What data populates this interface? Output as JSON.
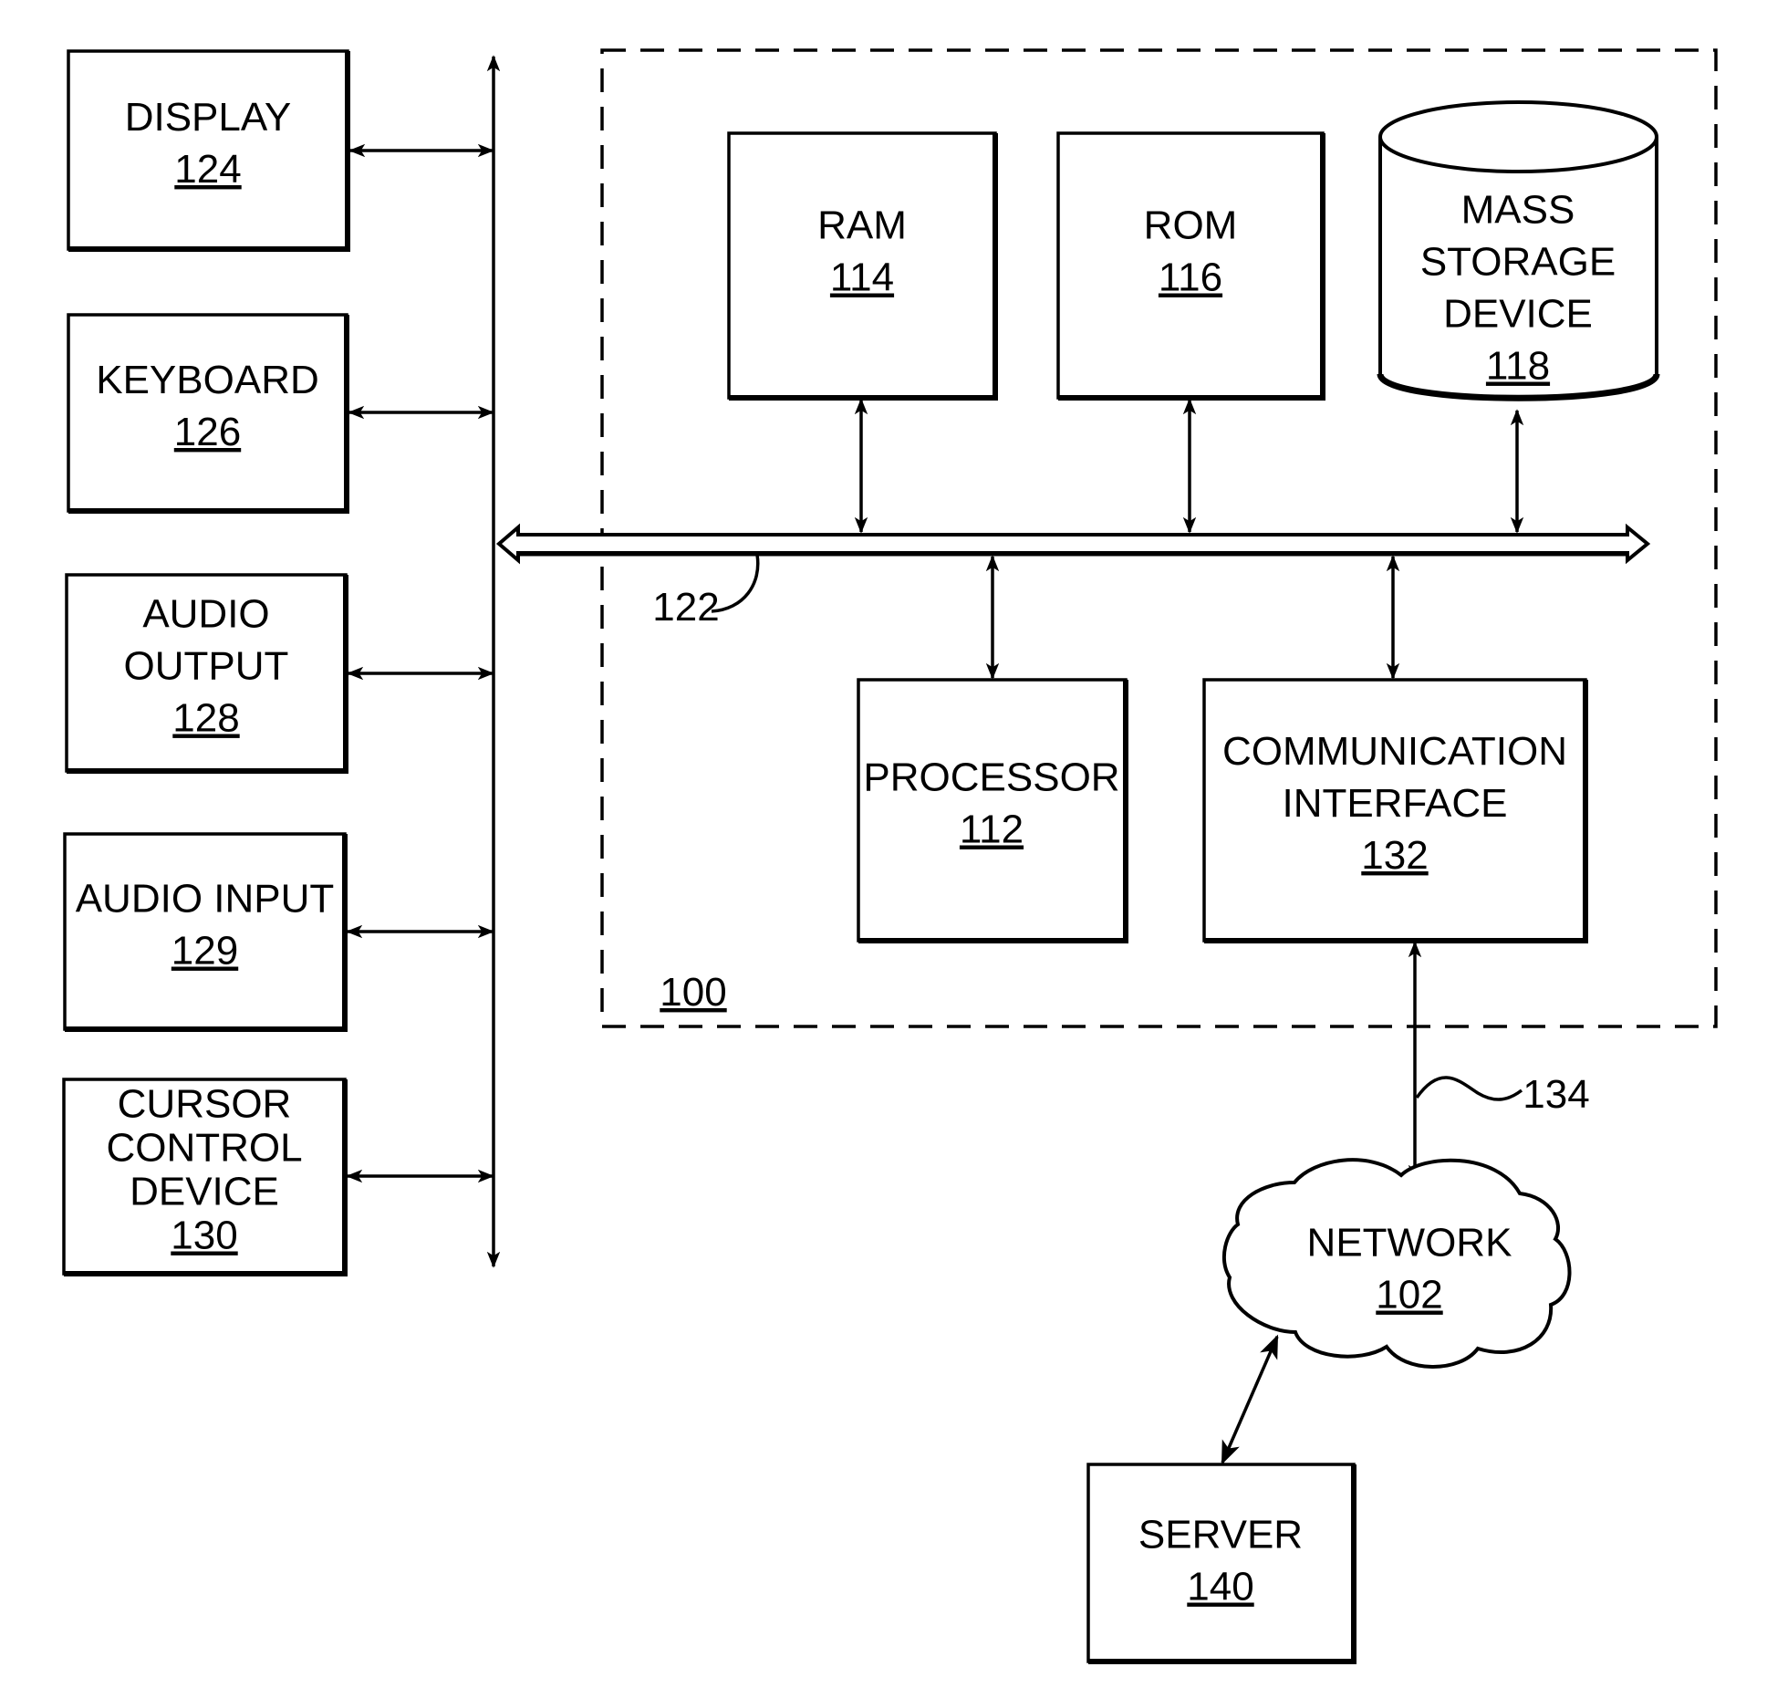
{
  "figure": {
    "system_label": "100",
    "bus_label": "122",
    "link_label": "134"
  },
  "external_devices": [
    {
      "lines": [
        "DISPLAY"
      ],
      "ref": "124"
    },
    {
      "lines": [
        "KEYBOARD"
      ],
      "ref": "126"
    },
    {
      "lines": [
        "AUDIO",
        "OUTPUT"
      ],
      "ref": "128"
    },
    {
      "lines": [
        "AUDIO INPUT"
      ],
      "ref": "129"
    },
    {
      "lines": [
        "CURSOR",
        "CONTROL",
        "DEVICE"
      ],
      "ref": "130"
    }
  ],
  "internal_components": {
    "ram": {
      "lines": [
        "RAM"
      ],
      "ref": "114"
    },
    "rom": {
      "lines": [
        "ROM"
      ],
      "ref": "116"
    },
    "mass_storage": {
      "lines": [
        "MASS",
        "STORAGE",
        "DEVICE"
      ],
      "ref": "118"
    },
    "processor": {
      "lines": [
        "PROCESSOR"
      ],
      "ref": "112"
    },
    "comm_interface": {
      "lines": [
        "COMMUNICATION",
        "INTERFACE"
      ],
      "ref": "132"
    }
  },
  "network": {
    "lines": [
      "NETWORK"
    ],
    "ref": "102"
  },
  "server": {
    "lines": [
      "SERVER"
    ],
    "ref": "140"
  }
}
